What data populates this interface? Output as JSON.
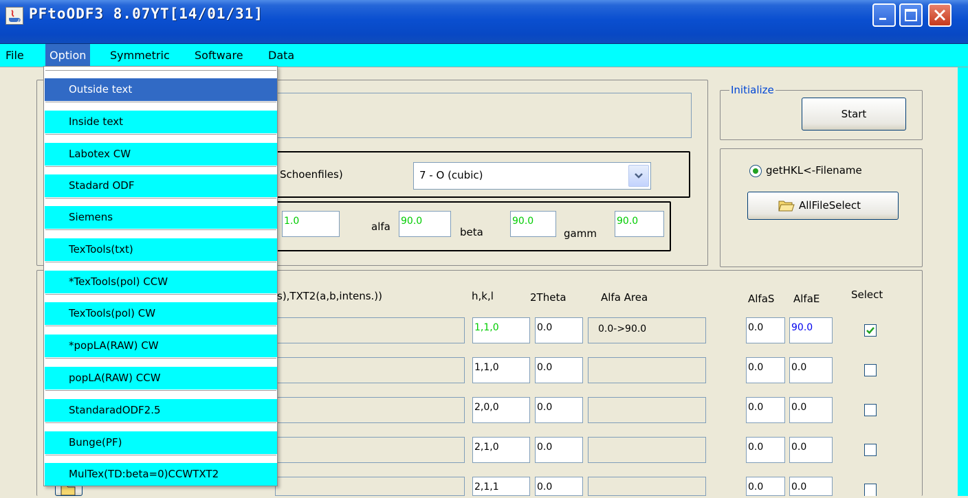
{
  "window": {
    "title": "PFtoODF3 8.07YT[14/01/31]"
  },
  "menubar": [
    "File",
    "Option",
    "Symmetric",
    "Software",
    "Data"
  ],
  "option_menu": [
    "Outside text",
    "Inside text",
    "Labotex CW",
    "Stadard ODF",
    "Siemens",
    "TexTools(txt)",
    "*TexTools(pol) CCW",
    "TexTools(pol) CW",
    "*popLA(RAW) CW",
    "popLA(RAW) CCW",
    "StandaradODF2.5",
    "Bunge(PF)",
    "MulTex(TD:beta=0)CCWTXT2"
  ],
  "symmetry": {
    "label_partial": "Schoenfiles)",
    "selected": "7 - O (cubic)"
  },
  "lattice": {
    "a_value": "1.0",
    "alfa_label": "alfa",
    "alfa": "90.0",
    "beta_label": "beta",
    "beta": "90.0",
    "gamm_label": "gamm",
    "gamm": "90.0"
  },
  "initialize": {
    "group_label": "Initialize",
    "start_button": "Start"
  },
  "file_select": {
    "radio_label": "getHKL<-Filename",
    "button_label": "AllFileSelect"
  },
  "table": {
    "format_label_partial": "s),TXT2(a,b,intens.))",
    "headers": {
      "hkl": "h,k,l",
      "theta": "2Theta",
      "alfa_area": "Alfa Area",
      "alfas": "AlfaS",
      "alfae": "AlfaE",
      "select": "Select"
    },
    "rows": [
      {
        "hkl": "1,1,0",
        "theta": "0.0",
        "area": "0.0->90.0",
        "alfas": "0.0",
        "alfae": "90.0",
        "checked": true
      },
      {
        "hkl": "1,1,0",
        "theta": "0.0",
        "area": "",
        "alfas": "0.0",
        "alfae": "0.0",
        "checked": false
      },
      {
        "hkl": "2,0,0",
        "theta": "0.0",
        "area": "",
        "alfas": "0.0",
        "alfae": "0.0",
        "checked": false
      },
      {
        "hkl": "2,1,0",
        "theta": "0.0",
        "area": "",
        "alfas": "0.0",
        "alfae": "0.0",
        "checked": false
      },
      {
        "hkl": "2,1,1",
        "theta": "0.0",
        "area": "",
        "alfas": "0.0",
        "alfae": "0.0",
        "checked": false
      }
    ]
  }
}
